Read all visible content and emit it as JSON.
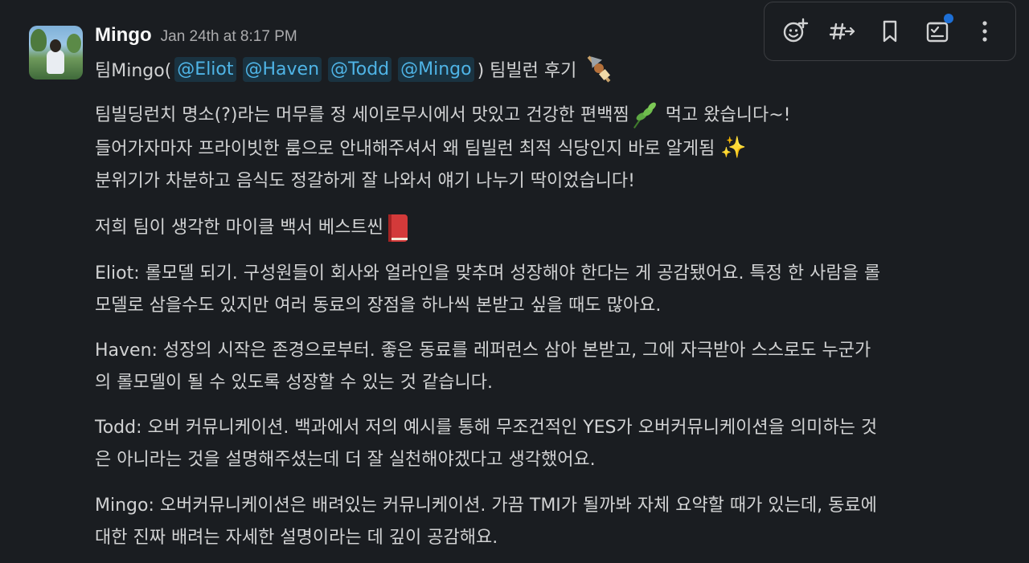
{
  "message": {
    "author": "Mingo",
    "timestamp": "Jan 24th at 8:17 PM",
    "first_line": {
      "prefix": "팀Mingo(",
      "mentions": [
        "@Eliot",
        "@Haven",
        "@Todd",
        "@Mingo"
      ],
      "suffix": ") 팀빌런 후기",
      "emoji": "oden-icon"
    },
    "paragraphs": {
      "p1": {
        "line1": "팀빌딩런치 명소(?)라는 머무를 정 세이로무시에서 맛있고 건강한 편백찜",
        "line1_after": " 먹고 왔습니다~!",
        "line2": "들어가자마자 프라이빗한 룸으로 안내해주셔서 왜 팀빌런 최적 식당인지 바로 알게됨 ",
        "line2_emoji": "✨",
        "line3": "분위기가 차분하고 음식도 정갈하게 잘 나와서 얘기 나누기 딱이었습니다!"
      },
      "p2": {
        "line1": "저희 팀이 생각한 마이클 백서 베스트씬"
      },
      "p3": {
        "line1": "Eliot: 롤모델 되기. 구성원들이 회사와 얼라인을 맞추며 성장해야 한다는 게 공감됐어요. 특정 한 사람을 롤",
        "line2": "모델로 삼을수도 있지만 여러 동료의 장점을 하나씩 본받고 싶을 때도 많아요."
      },
      "p4": {
        "line1": "Haven: 성장의 시작은 존경으로부터. 좋은 동료를 레퍼런스 삼아 본받고, 그에 자극받아 스스로도 누군가",
        "line2": "의 롤모델이 될 수 있도록 성장할 수 있는 것 같습니다."
      },
      "p5": {
        "line1": "Todd: 오버 커뮤니케이션. 백과에서 저의 예시를 통해 무조건적인 YES가 오버커뮤니케이션을 의미하는 것",
        "line2": "은 아니라는 것을 설명해주셨는데 더 잘 실천해야겠다고 생각했어요."
      },
      "p6": {
        "line1": "Mingo: 오버커뮤니케이션은 배려있는 커뮤니케이션. 가끔 TMI가 될까봐 자체 요약할 때가 있는데, 동료에",
        "line2": "대한 진짜 배려는 자세한 설명이라는 데 깊이 공감해요."
      }
    }
  },
  "toolbar": {
    "items": [
      "add-reaction-icon",
      "forward-to-channel-icon",
      "bookmark-icon",
      "save-for-later-icon",
      "more-actions-icon"
    ],
    "notification_color": "#1d6fd6"
  },
  "colors": {
    "background": "#1a1d21",
    "text": "#d1d2d3",
    "mention_text": "#4fb4e6"
  }
}
